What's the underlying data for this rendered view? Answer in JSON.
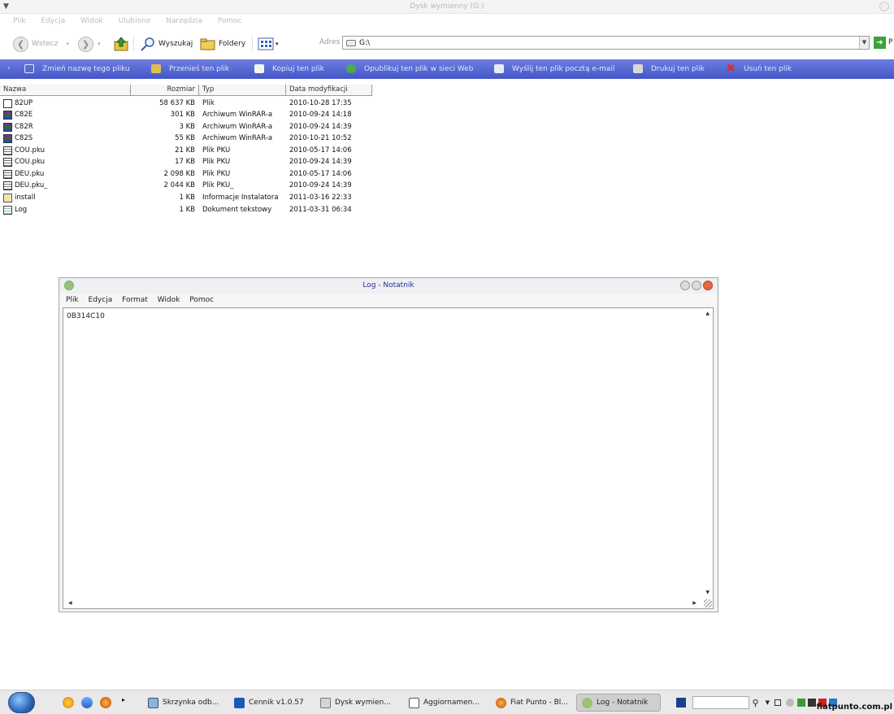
{
  "explorer": {
    "title": "Dysk wymienny (G:)",
    "menu": [
      "Plik",
      "Edycja",
      "Widok",
      "Ulubione",
      "Narzędzia",
      "Pomoc"
    ],
    "toolbar": {
      "back_label": "Wstecz",
      "search_label": "Wyszukaj",
      "folders_label": "Foldery"
    },
    "address": {
      "label": "Adres",
      "value": "G:\\",
      "go_label": "P"
    },
    "tasks": [
      "Zmień nazwę tego pliku",
      "Przenieś ten plik",
      "Kopiuj ten plik",
      "Opublikuj ten plik w sieci Web",
      "Wyślij ten plik pocztą e-mail",
      "Drukuj ten plik",
      "Usuń ten plik"
    ],
    "columns": [
      "Nazwa",
      "Rozmiar",
      "Typ",
      "Data modyfikacji"
    ],
    "files": [
      {
        "name": "82UP",
        "size": "58 637 KB",
        "type": "Plik",
        "date": "2010-10-28 17:35",
        "icon": "generic-file-icon"
      },
      {
        "name": "C82E",
        "size": "301 KB",
        "type": "Archiwum WinRAR-a",
        "date": "2010-09-24 14:18",
        "icon": "winrar-icon"
      },
      {
        "name": "C82R",
        "size": "3 KB",
        "type": "Archiwum WinRAR-a",
        "date": "2010-09-24 14:39",
        "icon": "winrar-icon"
      },
      {
        "name": "C82S",
        "size": "55 KB",
        "type": "Archiwum WinRAR-a",
        "date": "2010-10-21 10:52",
        "icon": "winrar-icon"
      },
      {
        "name": "COU.pku",
        "size": "21 KB",
        "type": "Plik PKU",
        "date": "2010-05-17 14:06",
        "icon": "pku-file-icon"
      },
      {
        "name": "COU.pku",
        "size": "17 KB",
        "type": "Plik PKU",
        "date": "2010-09-24 14:39",
        "icon": "pku-file-icon"
      },
      {
        "name": "DEU.pku",
        "size": "2 098 KB",
        "type": "Plik PKU",
        "date": "2010-05-17 14:06",
        "icon": "pku-file-icon"
      },
      {
        "name": "DEU.pku_",
        "size": "2 044 KB",
        "type": "Plik PKU_",
        "date": "2010-09-24 14:39",
        "icon": "pku-file-icon"
      },
      {
        "name": "install",
        "size": "1 KB",
        "type": "Informacje Instalatora",
        "date": "2011-03-16 22:33",
        "icon": "installer-info-icon"
      },
      {
        "name": "Log",
        "size": "1 KB",
        "type": "Dokument tekstowy",
        "date": "2011-03-31 06:34",
        "icon": "text-document-icon"
      }
    ]
  },
  "notepad": {
    "title": "Log - Notatnik",
    "menu": [
      "Plik",
      "Edycja",
      "Format",
      "Widok",
      "Pomoc"
    ],
    "content": "0B314C10"
  },
  "taskbar": {
    "buttons": [
      "Skrzynka odb...",
      "Cennik v1.0.57",
      "Dysk wymien...",
      "Aggiornamen...",
      "Fiat Punto - Bl...",
      "Log - Notatnik"
    ],
    "watermark": "fiatpunto.com.pl"
  },
  "colors": {
    "task_bar_top": "#6d7ee0",
    "task_bar_bottom": "#4456c8",
    "go_button": "#3aa23a",
    "notepad_close": "#e8663a"
  }
}
